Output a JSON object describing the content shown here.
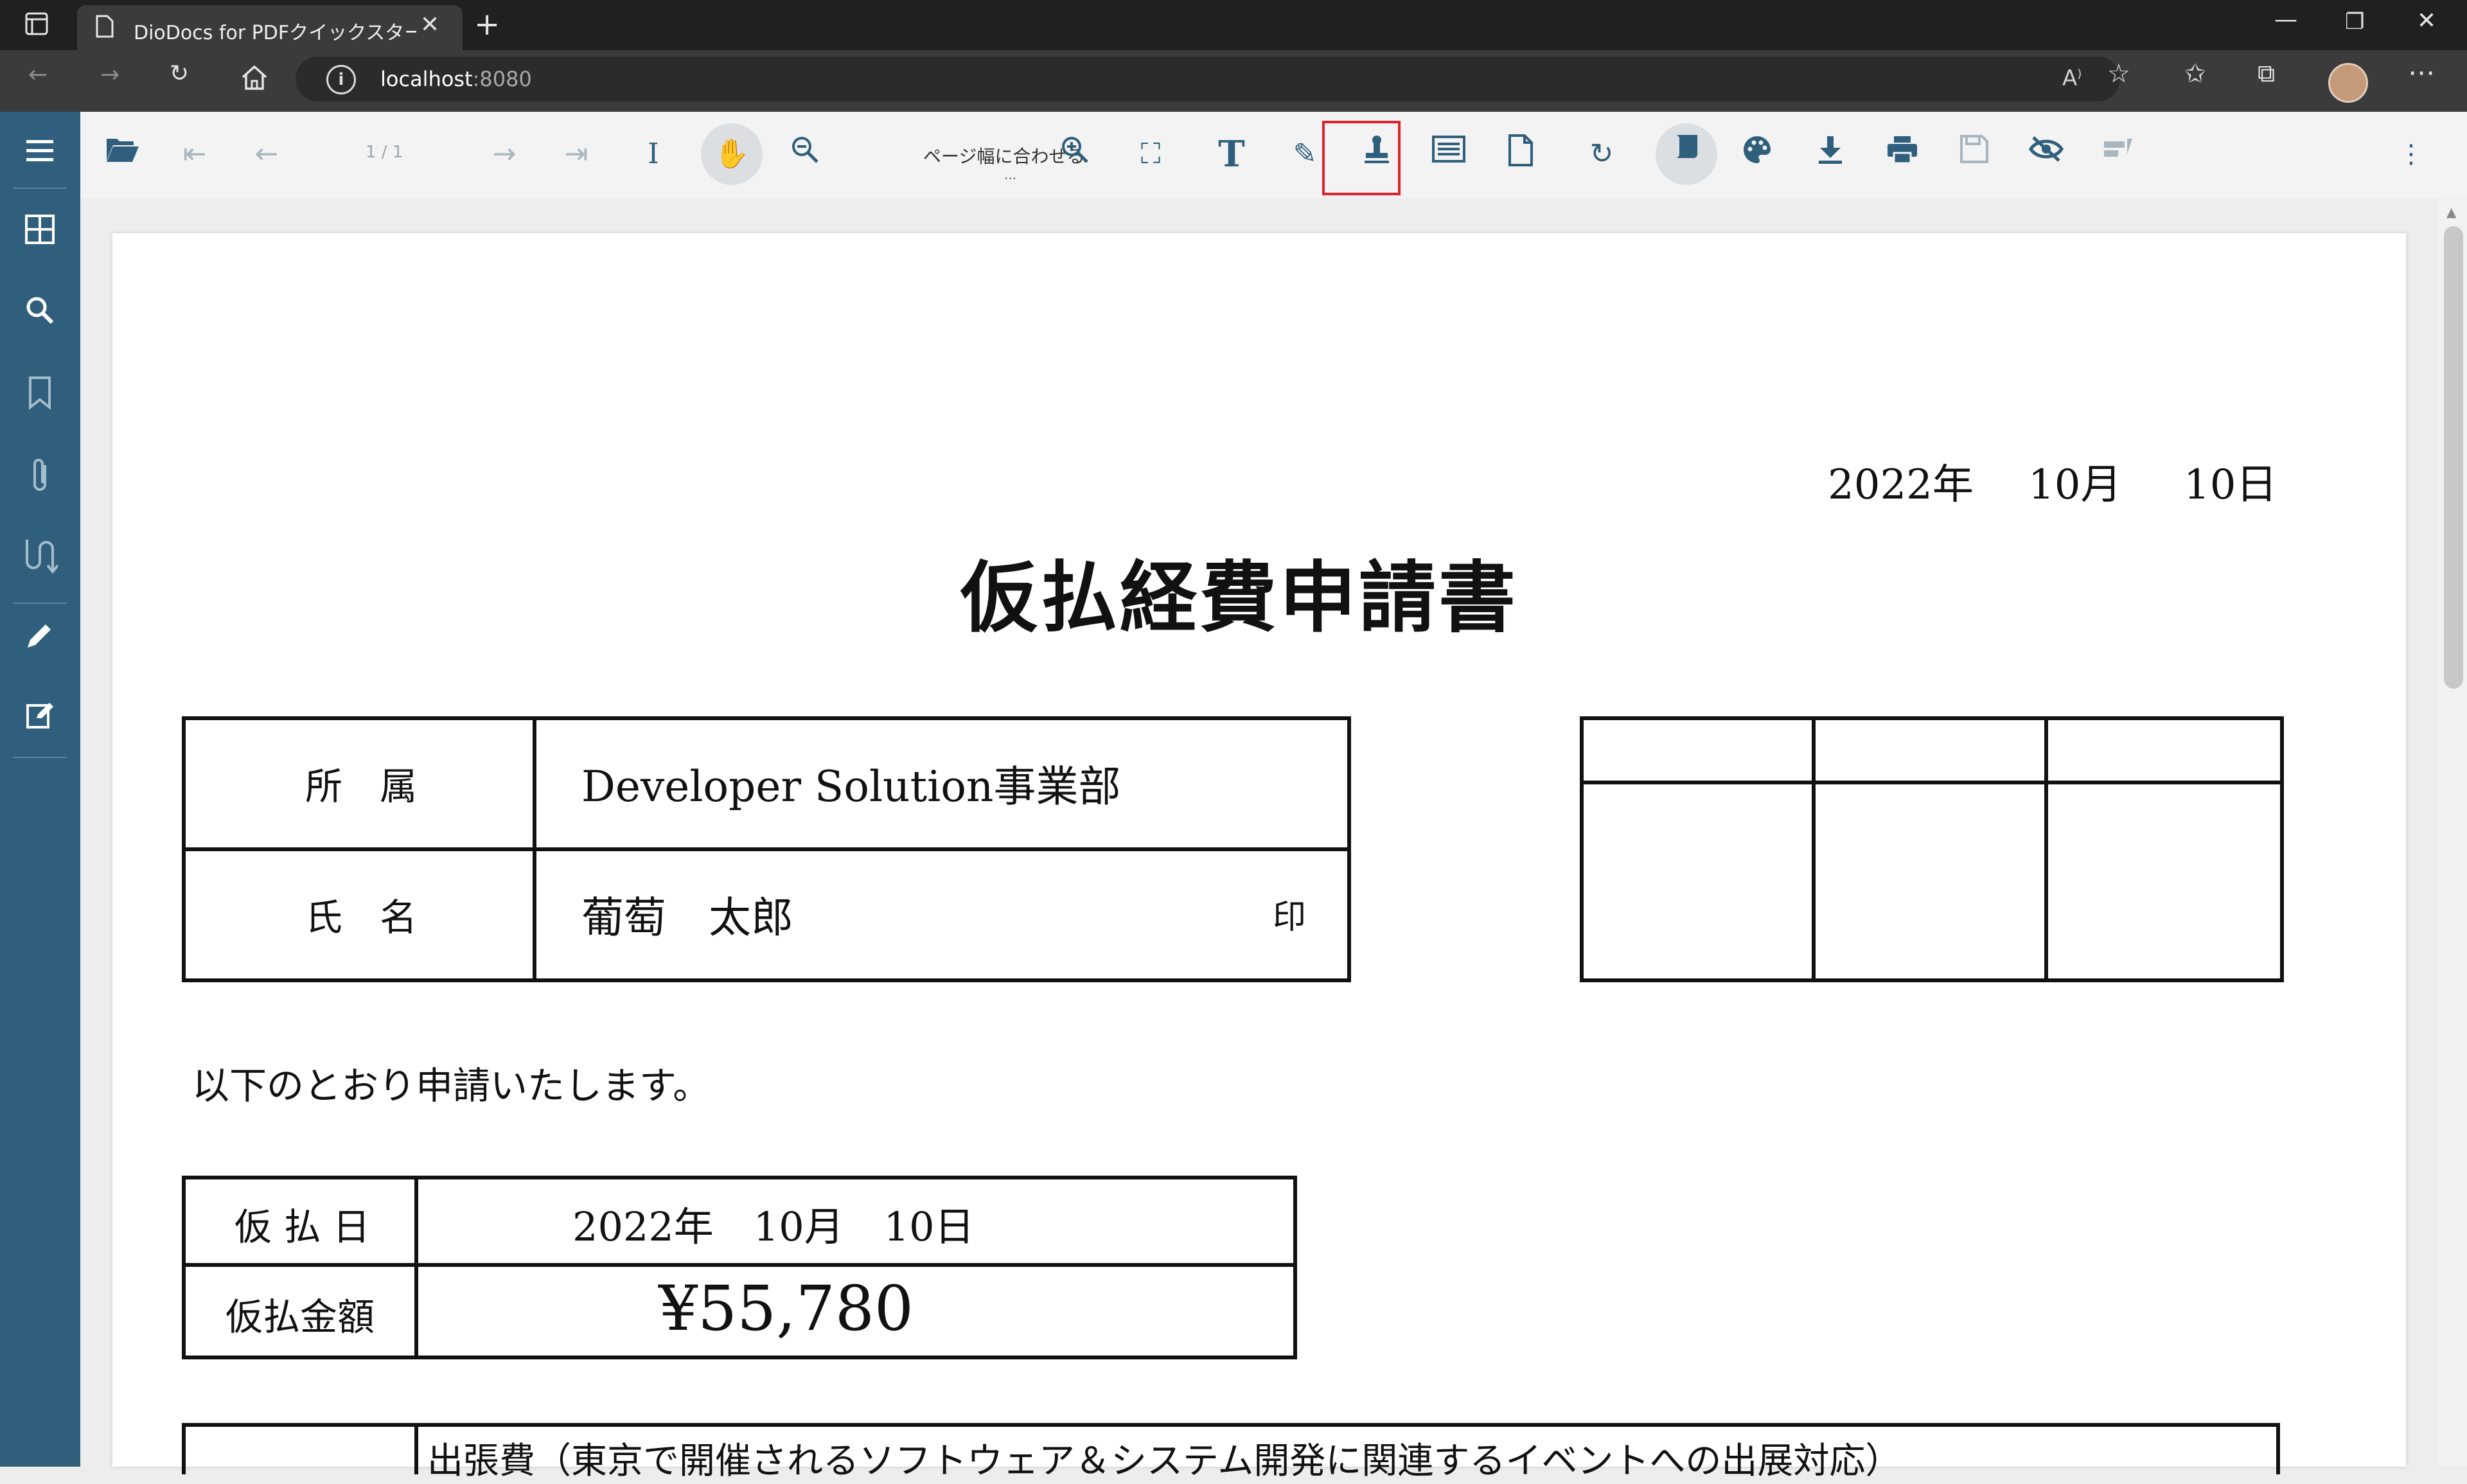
{
  "browser": {
    "tab_title": "DioDocs for PDFクイックスタート | P",
    "url_host": "localhost",
    "url_port": ":8080"
  },
  "toolbar": {
    "page_indicator": "1 / 1",
    "zoom_label": "ページ幅に合わせる",
    "zoom_more": "..."
  },
  "document": {
    "date_year": "2022年",
    "date_month": "10月",
    "date_day": "10日",
    "title": "仮払経費申請書",
    "dept_label": "所　属",
    "dept_value": "Developer Solution事業部",
    "name_label": "氏　名",
    "name_value": "葡萄　太郎",
    "seal_label": "印",
    "intro_text": "以下のとおり申請いたします。",
    "advance_date_label": "仮 払 日",
    "advance_date_value": "2022年　10月　10日",
    "advance_amount_label": "仮払金額",
    "advance_amount_value": "¥55,780",
    "expense_item_partial": "出張費（東京で開催されるソフトウェア＆システム開発に関連するイベントへの出展対応）"
  },
  "colors": {
    "sidebar": "#2f5f7c",
    "icon_accent": "#2f5f7c",
    "highlight": "#e0202a"
  }
}
